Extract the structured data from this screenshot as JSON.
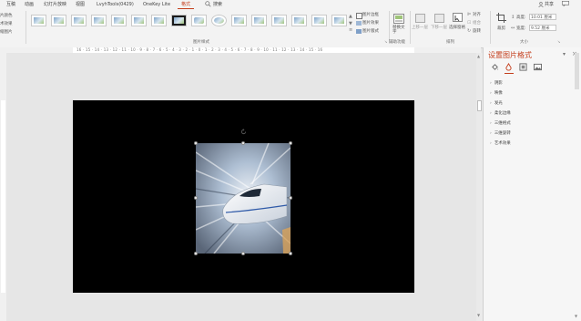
{
  "tabs": [
    {
      "label": "互稿"
    },
    {
      "label": "动画"
    },
    {
      "label": "幻灯片放映"
    },
    {
      "label": "视图"
    },
    {
      "label": "LvyhTools(0429)"
    },
    {
      "label": "OneKey Lite"
    },
    {
      "label": "格式"
    },
    {
      "label": "搜索"
    }
  ],
  "share_label": "共享",
  "left_cut": [
    "片颜色",
    "术效果",
    "缩图片"
  ],
  "picture_styles_label": "图片样式",
  "picture_style_menu": [
    "图片边框",
    "图片效果",
    "图片版式"
  ],
  "accessibility": {
    "button": "替换文字",
    "group": "辅助功能"
  },
  "arrange": {
    "bring_forward": "上移一层",
    "send_backward": "下移一层",
    "selection_pane": "选择窗格",
    "align": "对齐",
    "group": "组合",
    "rotate": "旋转",
    "group_label": "排列"
  },
  "size": {
    "crop": "裁剪",
    "height_label": "高度:",
    "height_value": "10.01 厘米",
    "width_label": "宽度:",
    "width_value": "9.52 厘米",
    "group_label": "大小"
  },
  "ruler_text": "16 · 15 · 14 · 13 · 12 · 11 · 10 · 9 · 8 · 7 · 6 · 5 · 4 · 3 · 2 · 1 · 0 · 1 · 2 · 3 · 4 · 5 · 6 · 7 · 8 · 9 · 10 · 11 · 12 · 13 · 14 · 15 · 16",
  "pane": {
    "title": "设置图片格式",
    "sections": [
      "阴影",
      "映像",
      "发光",
      "柔化边缘",
      "三维格式",
      "三维旋转",
      "艺术效果"
    ]
  },
  "colors": {
    "accent": "#c43e1c",
    "slide_bg": "#000000"
  }
}
